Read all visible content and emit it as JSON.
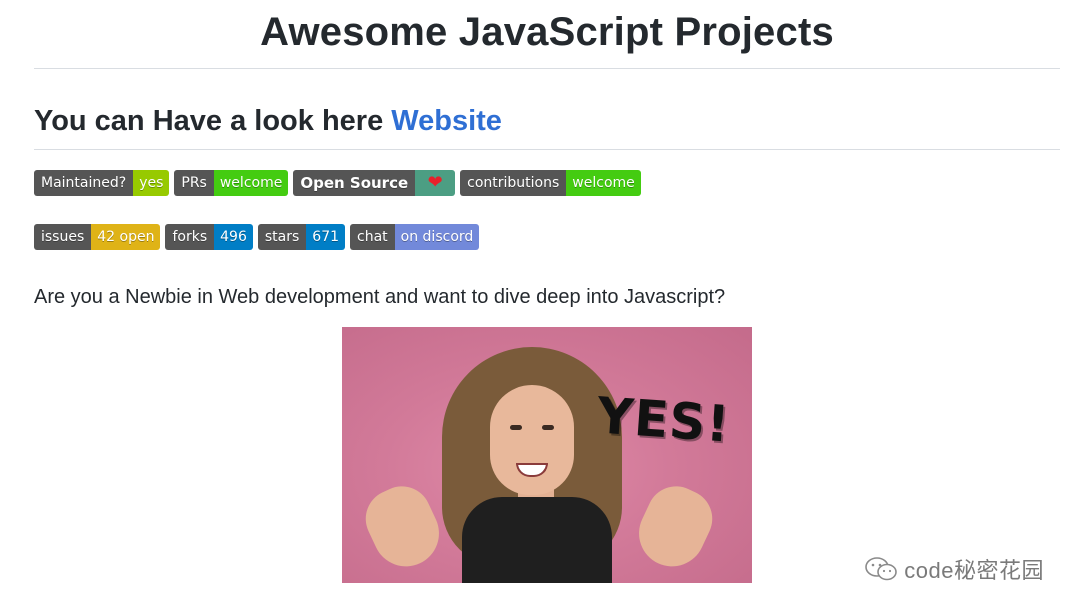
{
  "header": {
    "title": "Awesome JavaScript Projects"
  },
  "subtitle": {
    "prefix": "You can Have a look here ",
    "link": "Website"
  },
  "badges_row1": [
    {
      "label": "Maintained?",
      "value": "yes",
      "color": "#97ca00"
    },
    {
      "label": "PRs",
      "value": "welcome",
      "color": "#4c1"
    },
    {
      "label": "Open Source",
      "value": "❤",
      "color": "#4c9e83",
      "bold": true
    },
    {
      "label": "contributions",
      "value": "welcome",
      "color": "#4c1"
    }
  ],
  "badges_row2": [
    {
      "label": "issues",
      "value": "42 open",
      "color": "#dfb317"
    },
    {
      "label": "forks",
      "value": "496",
      "color": "#007ec6"
    },
    {
      "label": "stars",
      "value": "671",
      "color": "#007ec6"
    },
    {
      "label": "chat",
      "value": "on discord",
      "color": "#7289da"
    }
  ],
  "question": "Are you a Newbie in Web development and want to dive deep into Javascript?",
  "gif": {
    "caption": "YES!"
  },
  "watermark": {
    "text": "code秘密花园",
    "icon": "wechat-icon"
  }
}
